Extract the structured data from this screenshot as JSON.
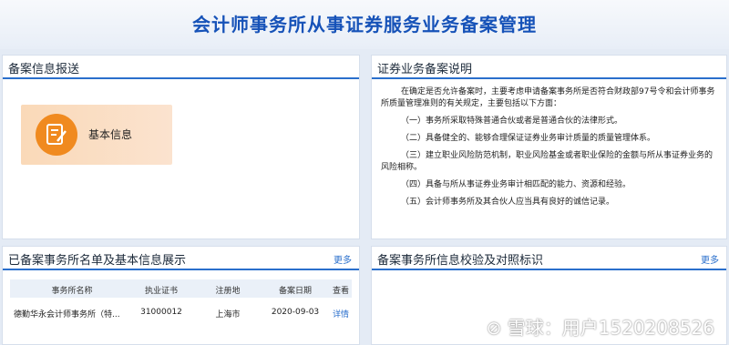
{
  "banner": {
    "title": "会计师事务所从事证券服务业务备案管理"
  },
  "filing_panel": {
    "title": "备案信息报送",
    "card_label": "基本信息",
    "card_icon": "document-edit-icon"
  },
  "explain_panel": {
    "title": "证券业务备案说明",
    "intro": "在确定是否允许备案时，主要考虑申请备案事务所是否符合财政部97号令和会计师事务所质量管理准则的有关规定，主要包括以下方面：",
    "items": [
      "（一）事务所采取特殊普通合伙或者是普通合伙的法律形式。",
      "（二）具备健全的、能够合理保证证券业务审计质量的质量管理体系。",
      "（三）建立职业风险防范机制，职业风险基金或者职业保险的金额与所从事证券业务的风险相称。",
      "（四）具备与所从事证券业务审计相匹配的能力、资源和经验。",
      "（五）会计师事务所及其合伙人应当具有良好的诚信记录。"
    ]
  },
  "list_panel": {
    "title": "已备案事务所名单及基本信息展示",
    "more": "更多",
    "columns": [
      "事务所名称",
      "执业证书",
      "注册地",
      "备案日期",
      "查看"
    ],
    "rows": [
      {
        "name": "德勤华永会计师事务所（特...",
        "cert": "31000012",
        "location": "上海市",
        "date": "2020-09-03",
        "action": "详情"
      }
    ]
  },
  "verify_panel": {
    "title": "备案事务所信息校验及对照标识",
    "more": "更多"
  },
  "watermark": {
    "text": "雪球：用户1520208526",
    "icon": "snowball-logo-icon"
  },
  "colors": {
    "accent": "#2a6fcc",
    "title_blue": "#1652b8",
    "card_orange": "#f08a1f"
  }
}
